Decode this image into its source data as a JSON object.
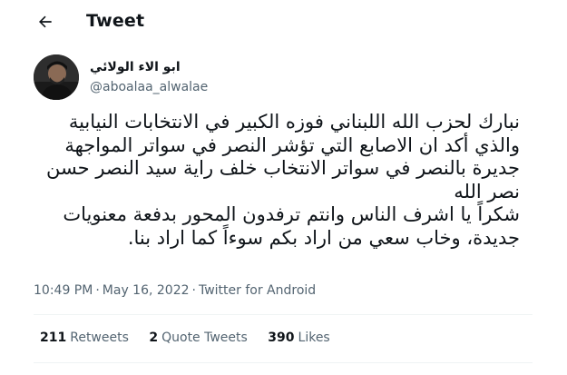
{
  "header": {
    "title": "Tweet"
  },
  "user": {
    "display_name": "ابو الاء الولائي",
    "handle": "@aboalaa_alwalae"
  },
  "tweet": {
    "lines": [
      "نبارك لحزب الله اللبناني فوزه الكبير في الانتخابات النيابية",
      "والذي أكد ان الاصابع التي تؤشر النصر في سواتر المواجهة",
      "جديرة بالنصر في سواتر الانتخاب خلف راية سيد النصر حسن",
      "نصر الله",
      "شكراً يا اشرف الناس وانتم ترفدون المحور بدفعة معنويات",
      "جديدة، وخاب سعي من اراد بكم سوءاً كما اراد بنا."
    ],
    "time": "10:49 PM",
    "date": "May 16, 2022",
    "source": "Twitter for Android",
    "separator": "·"
  },
  "stats": {
    "retweets_count": "211",
    "retweets_label": "Retweets",
    "quotes_count": "2",
    "quotes_label": "Quote Tweets",
    "likes_count": "390",
    "likes_label": "Likes"
  },
  "icons": {
    "back": "arrow-left-icon"
  }
}
